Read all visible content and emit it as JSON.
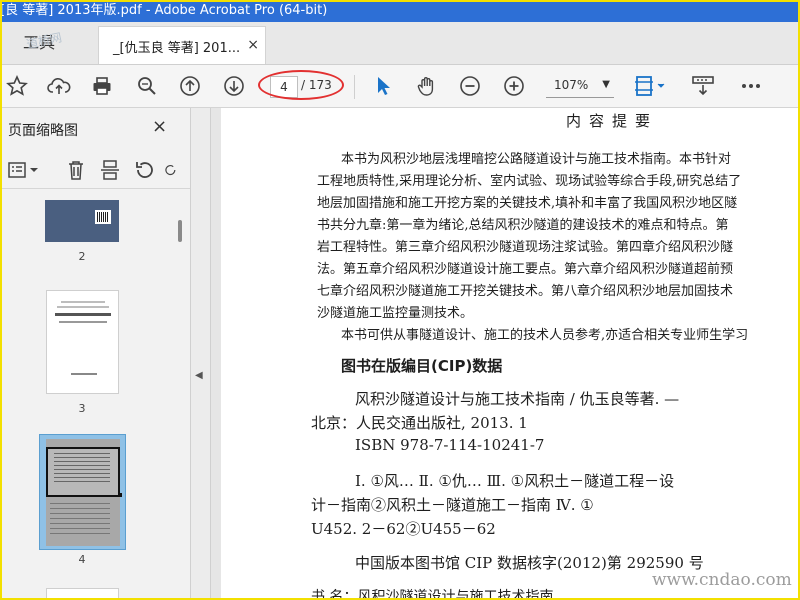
{
  "window": {
    "title": "[良 等著] 2013年版.pdf - Adobe Acrobat Pro (64-bit)"
  },
  "tabs": {
    "tools_label": "工具",
    "doc_tab_label": "_[仇玉良 等著] 201...",
    "close_glyph": "×"
  },
  "watermarks": {
    "top_left": "道桥网",
    "bottom_right": "www.cndao.com"
  },
  "toolbar": {
    "page_current": "4",
    "page_total": "/ 173",
    "zoom": "107%",
    "icons": [
      "star-icon",
      "cloud-upload-icon",
      "print-icon",
      "search-zoom-icon",
      "arrow-up-icon",
      "arrow-down-icon",
      "select-cursor-icon",
      "hand-icon",
      "zoom-out-icon",
      "zoom-in-icon",
      "fit-page-icon",
      "scroll-mode-icon",
      "more-icon"
    ],
    "accent_color": "#1a73c8",
    "highlight_color": "#e23030"
  },
  "panel": {
    "title": "页面缩略图",
    "close_glyph": "×",
    "thumbnails": [
      {
        "num": "2"
      },
      {
        "num": "3"
      },
      {
        "num": "4",
        "selected": true
      }
    ],
    "collapse_glyph": "◀"
  },
  "document": {
    "heading": "内容提要",
    "paragraphs": [
      "本书为风积沙地层浅埋暗挖公路隧道设计与施工技术指南。本书针对",
      "工程地质特性,采用理论分析、室内试验、现场试验等综合手段,研究总结了",
      "地层加固措施和施工开挖方案的关键技术,填补和丰富了我国风积沙地区隧",
      "书共分九章:第一章为绪论,总结风积沙隧道的建设技术的难点和特点。第",
      "岩工程特性。第三章介绍风积沙隧道现场注浆试验。第四章介绍风积沙隧",
      "法。第五章介绍风积沙隧道设计施工要点。第六章介绍风积沙隧道超前预",
      "七章介绍风积沙隧道施工开挖关键技术。第八章介绍风积沙地层加固技术",
      "沙隧道施工监控量测技术。",
      "本书可供从事隧道设计、施工的技术人员参考,亦适合相关专业师生学习"
    ],
    "cip_title": "图书在版编目(CIP)数据",
    "cip_lines": [
      "风积沙隧道设计与施工技术指南 / 仇玉良等著. —",
      "北京：人民交通出版社, 2013. 1",
      "ISBN 978-7-114-10241-7",
      "Ⅰ. ①风… Ⅱ. ①仇… Ⅲ. ①风积土－隧道工程－设",
      "计－指南②风积土－隧道施工－指南 Ⅳ. ①",
      "U452. 2－62②U455－62",
      "中国版本图书馆 CIP 数据核字(2012)第 292590 号",
      "书    名：风积沙隧道设计与施工技术指南"
    ]
  }
}
